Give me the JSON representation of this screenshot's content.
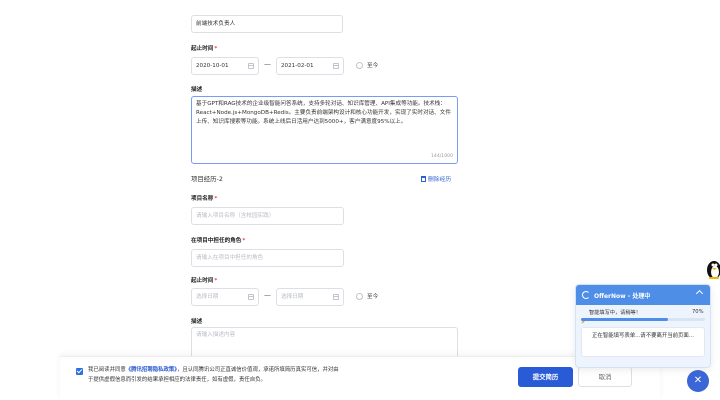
{
  "form": {
    "role_value": "前端技术负责人",
    "period1": {
      "label": "起止时间",
      "required_mark": "*",
      "start": "2020-10-01",
      "end": "2021-02-01",
      "separator": "—",
      "present_label": "至今"
    },
    "desc1": {
      "label": "描述",
      "text": "基于GPT和RAG技术的企业级智能问答系统，支持多轮对话、知识库管理、API集成等功能。技术栈：React+Node.js+MongoDB+Redis。主要负责前端架构设计和核心功能开发，实现了实时对话、文件上传、知识库搜索等功能。系统上线后日活用户达到5000+，客户满意度95%以上。",
      "counter": "144/1000"
    },
    "project2": {
      "title": "项目经历-2",
      "delete_label": "删除经历",
      "name_label": "项目名称",
      "name_placeholder": "请输入项目名称（含校园实践）",
      "role_label": "在项目中担任的角色",
      "role_placeholder": "请输入在项目中担任的角色",
      "period_label": "起止时间",
      "start_placeholder": "选择日期",
      "end_placeholder": "选择日期",
      "separator": "—",
      "present_label": "至今",
      "desc_label": "描述",
      "desc_placeholder": "请输入描述内容"
    },
    "required_mark": "*"
  },
  "footer": {
    "agree_prefix": "我已阅读并同意",
    "agree_link": "《腾讯招聘隐私政策》",
    "agree_rest_line1": "，且认同腾讯公司正直诚信价值观，承诺所填简历真实可信，并对由",
    "agree_line2": "于提供虚假信息而引发的结果承担相应的法律责任，如有虚假，责任自负。",
    "submit_label": "提交简历",
    "cancel_label": "取消"
  },
  "assistant": {
    "title": "OfferNow - 处理中",
    "collapse_icon": "chevron-up-icon",
    "status_text": "智能填写中，请稍等！",
    "progress_percent": 70,
    "progress_label": "70%",
    "notice": "正在智能填写表单...请不要离开当前页面..."
  },
  "colors": {
    "accent": "#2a5bd7",
    "link": "#2f5fd0",
    "required": "#e54545",
    "panel_head": "#4f8ee6",
    "progress": "#4f8ee6"
  }
}
